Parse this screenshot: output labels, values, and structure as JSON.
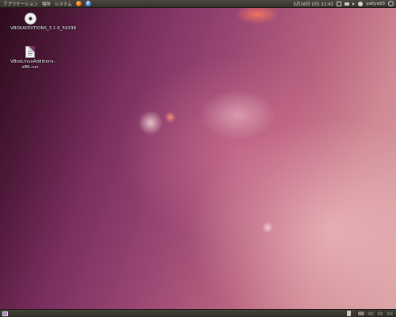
{
  "top_panel": {
    "menus": [
      "アプリケーション",
      "場所",
      "システム"
    ],
    "launchers": [
      "firefox-icon",
      "help-icon"
    ],
    "help_glyph": "?",
    "clock": "5月16日 (日) 21:42",
    "user": "yaltya93"
  },
  "desktop_icons": [
    {
      "label": "VBOXADDITIONS_3.1.6_59338",
      "icon": "cd-disc-icon"
    },
    {
      "label": "VBoxLinuxAdditions-x86.run",
      "icon": "text-file-icon"
    }
  ],
  "bottom_panel": {
    "workspaces": 4,
    "active_workspace": 1
  },
  "colors": {
    "panel": "#3c3934",
    "wallpaper_dark": "#2c0a1c",
    "wallpaper_light": "#d9a1a4"
  }
}
